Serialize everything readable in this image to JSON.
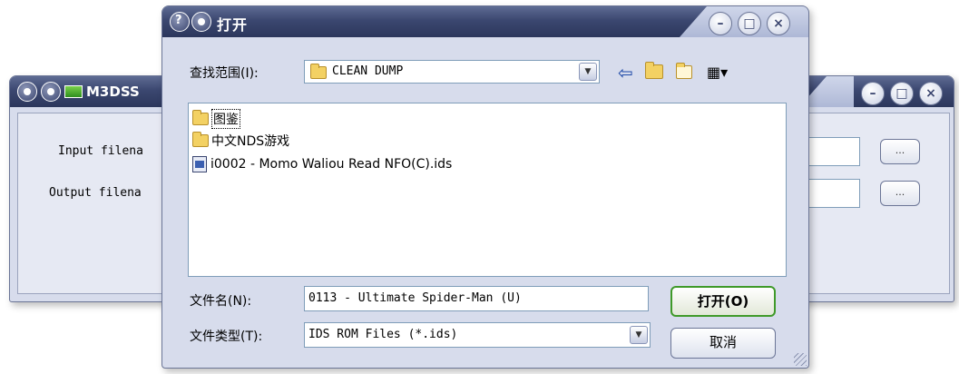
{
  "back_window": {
    "title": "M3DSS",
    "input_label": "Input filena",
    "output_label": "Output filena",
    "browse_label": "..."
  },
  "dialog": {
    "title": "打开",
    "look_in_label": "查找范围(I):",
    "look_in_value": "CLEAN DUMP",
    "files": [
      {
        "name": "图鉴",
        "type": "folder"
      },
      {
        "name": "中文NDS游戏",
        "type": "folder"
      },
      {
        "name": "i0002 - Momo Waliou Read NFO(C).ids",
        "type": "file"
      }
    ],
    "filename_label": "文件名(N):",
    "filename_value": "0113 - Ultimate Spider-Man (U)",
    "filetype_label": "文件类型(T):",
    "filetype_value": "IDS ROM Files (*.ids)",
    "open_button": "打开(O)",
    "cancel_button": "取消"
  },
  "icons": {
    "back": "back-arrow-icon",
    "up": "up-folder-icon",
    "new_folder": "new-folder-icon",
    "view_menu": "view-menu-icon"
  },
  "colors": {
    "titlebar": "#3b4770",
    "window_bg": "#d7dcec",
    "primary_button_border": "#3f9a2a"
  }
}
